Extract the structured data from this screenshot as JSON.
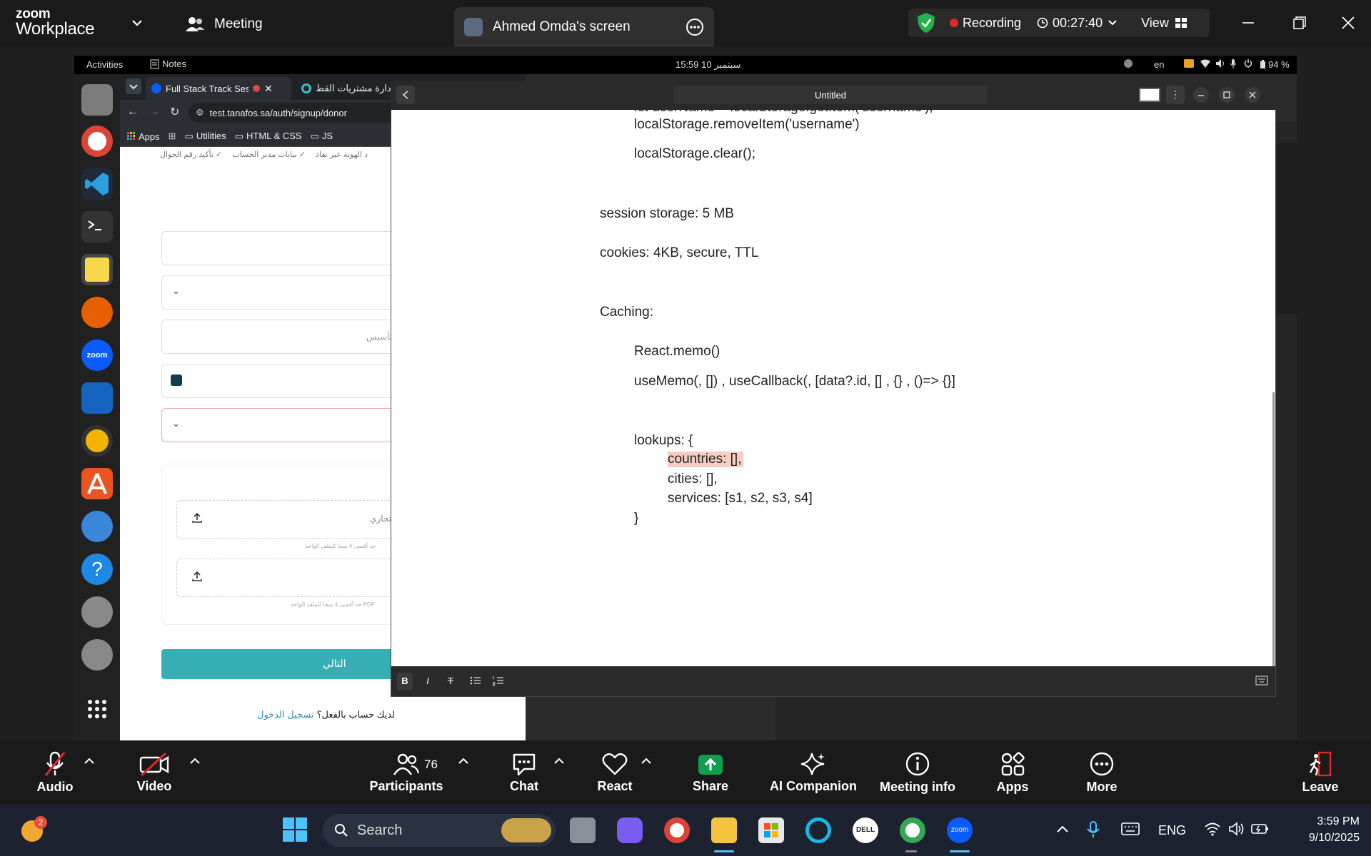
{
  "zoom": {
    "logo_line1": "zoom",
    "logo_line2": "Workplace",
    "meeting_label": "Meeting",
    "screen_tab_label": "Ahmed Omda's screen",
    "recording_label": "Recording",
    "timer": "00:27:40",
    "view_label": "View"
  },
  "ubuntu": {
    "activities": "Activities",
    "notes_app": "Notes",
    "datetime": "15:59  10 سبتمبر",
    "lang": "en",
    "battery": "94 %"
  },
  "chrome": {
    "tab1": "Full Stack Track Sessi",
    "tab2": "إدارة مشتريات القط",
    "url": "test.tanafos.sa/auth/signup/donor",
    "bookmarks": [
      "Apps",
      "Utilities",
      "HTML & CSS",
      "JS"
    ],
    "steps": [
      "تأكيد رقم الجوال",
      "بيانات مدير الحساب",
      "د الهوية عبر نفاذ"
    ],
    "placeholder_founding": "التأسيس",
    "upload_label": "تجاري )",
    "upload_hint1": "حد أقصى 4 ميجا للملف الواحد",
    "upload_hint2": "حد أقصى 4 ميجا للملف الواحد PDF",
    "next_button": "التالي",
    "login_prompt": "لديك حساب بالفعل؟",
    "login_link": "تسجيل الدخول"
  },
  "note": {
    "title": "Untitled",
    "lines": {
      "l0": "let userName = localStorage.getItem('username');",
      "l1": "localStorage.removeItem('username')",
      "l2": "localStorage.clear();",
      "l3": "session storage: 5 MB",
      "l4": "cookies: 4KB, secure, TTL",
      "l5": "Caching:",
      "l6": "React.memo()",
      "l7": "useMemo(, []) , useCallback(, [data?.id, [] , {} , ()=> {}]",
      "l8": "lookups: {",
      "l9": "countries: [],",
      "l10": "cities: [],",
      "l11": "services: [s1, s2, s3, s4]",
      "l12": "}"
    },
    "toolbar": {
      "bold": "B",
      "italic": "I",
      "strike": "T"
    }
  },
  "controls": {
    "audio": "Audio",
    "video": "Video",
    "participants": "Participants",
    "participants_count": "76",
    "chat": "Chat",
    "react": "React",
    "share": "Share",
    "ai": "AI Companion",
    "info": "Meeting info",
    "apps": "Apps",
    "more": "More",
    "leave": "Leave"
  },
  "taskbar": {
    "search": "Search",
    "badge": "2",
    "lang": "ENG",
    "time": "3:59 PM",
    "date": "9/10/2025"
  },
  "colors": {
    "share_green": "#0e9f4f",
    "recording_red": "#e02828",
    "shield_green": "#22b14c",
    "next_button": "#35afb4",
    "highlight": "#f6cdc4",
    "zoom_blue": "#0b5cff"
  }
}
